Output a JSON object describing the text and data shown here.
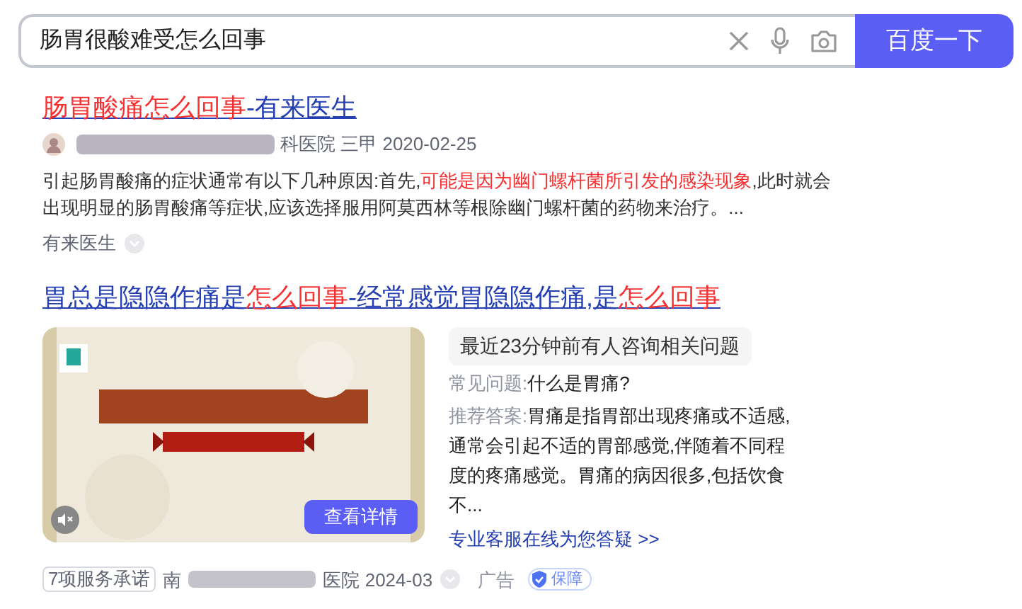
{
  "search": {
    "value": "肠胃很酸难受怎么回事",
    "button": "百度一下"
  },
  "results": [
    {
      "title": [
        {
          "text": "肠胃酸痛怎么回事",
          "highlight": true
        },
        {
          "text": "-有来医生",
          "highlight": false
        }
      ],
      "meta": {
        "source_suffix": "科医院 三甲 2020-02-25"
      },
      "snippet": [
        {
          "text": "引起肠胃酸痛的症状通常有以下几种原因:首先,",
          "highlight": false
        },
        {
          "text": "可能是因为幽门螺杆菌所引发的感染现象",
          "highlight": true
        },
        {
          "text": ",此时就会出现明显的肠胃酸痛等症状,应该选择服用阿莫西林等根除幽门螺杆菌的药物来治疗。...",
          "highlight": false
        }
      ],
      "site": "有来医生"
    }
  ],
  "ad": {
    "title": [
      {
        "text": "胃总是隐隐作痛是",
        "highlight": false
      },
      {
        "text": "怎么回事",
        "highlight": true
      },
      {
        "text": "-经常感觉胃隐隐作痛,是",
        "highlight": false
      },
      {
        "text": "怎么回事",
        "highlight": true
      }
    ],
    "video": {
      "details_button": "查看详情"
    },
    "notice": "最近23分钟前有人咨询相关问题",
    "qa": [
      {
        "label": "常见问题:",
        "text": "什么是胃痛?"
      },
      {
        "label": "推荐答案:",
        "text": "胃痛是指胃部出现疼痛或不适感,通常会引起不适的胃部感觉,伴随着不同程度的疼痛感觉。胃痛的病因很多,包括饮食不..."
      }
    ],
    "service_link": "专业客服在线为您答疑 >>",
    "badge": "7项服务承诺",
    "source_prefix": "南",
    "source_suffix": "医院 2024-03",
    "ad_label": "广告",
    "guarantee": "保障"
  }
}
